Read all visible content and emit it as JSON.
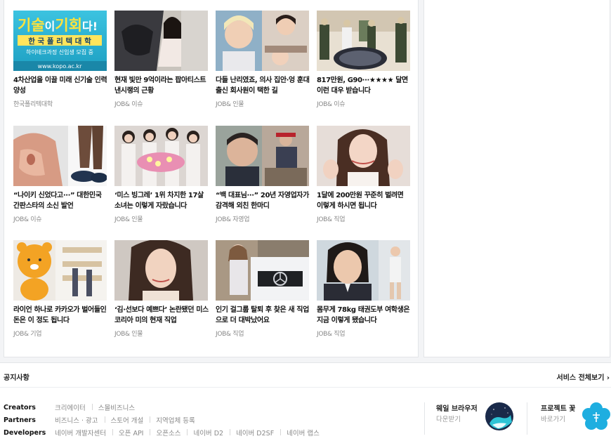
{
  "cards": [
    {
      "title": "4차산업을 이끌 미래 신기술 인력 양성",
      "source": "한국폴리텍대학",
      "thumb": "ad-kopo",
      "ad": {
        "headline_a": "기술",
        "headline_b": "이",
        "headline_c": "기회",
        "headline_d": "다!",
        "org": "한 국 폴 리 텍 대 학",
        "sub": "하이테크과정 신입생 모집 중",
        "url": "www.kopo.ac.kr"
      }
    },
    {
      "title": "현재 빛만 9억이라는 팝아티스트 낸시랭의 근황",
      "source": "JOB& 이슈",
      "thumb": "woman-sitting"
    },
    {
      "title": "다들 난리였죠, 의사 집안·엉 훈대 출신 회사원이 택한 길",
      "source": "JOB& 인물",
      "thumb": "portraits"
    },
    {
      "title": "817만원, G90···★★★★ 달면 이런 대우 받습니다",
      "source": "JOB& 이슈",
      "thumb": "officers"
    },
    {
      "title": "“나이키 신었다고···” 대한민국 간판스타의 소신 발언",
      "source": "JOB& 이슈",
      "thumb": "feet"
    },
    {
      "title": "‘미스 빙그레’ 1위 차지한 17살 소녀는 이렇게 자랐습니다",
      "source": "JOB& 인물",
      "thumb": "girls"
    },
    {
      "title": "“백 대표님···” 20년 자영업자가 감격해 외친 한마디",
      "source": "JOB& 자영업",
      "thumb": "chef"
    },
    {
      "title": "1달에 200만원 꾸준히 벌려면 이렇게 하시면 됩니다",
      "source": "JOB& 직업",
      "thumb": "waving"
    },
    {
      "title": "라이언 하나로 카카오가 벌어들인 돈은 이 정도 됩니다",
      "source": "JOB& 기업",
      "thumb": "ryan"
    },
    {
      "title": "‘김·선보다 예쁘다’ 논란됐던 미스코리아 미의 현재 직업",
      "source": "JOB& 인물",
      "thumb": "misskorea"
    },
    {
      "title": "인기 걸그룹 탈퇴 후 찾은 새 직업으로 더 대박났어요",
      "source": "JOB& 직업",
      "thumb": "mercedes"
    },
    {
      "title": "몸무게 78kg 태권도부 여학생은 지금 이렇게 됐습니다",
      "source": "JOB& 직업",
      "thumb": "student"
    }
  ],
  "footer": {
    "notice_label": "공지사항",
    "service_all": "서비스 전체보기 ›",
    "rows": [
      {
        "heading": "Creators",
        "links": [
          "크리에이터",
          "스몰비즈니스"
        ]
      },
      {
        "heading": "Partners",
        "links": [
          "비즈니스 · 광고",
          "스토어 개설",
          "지역업체 등록"
        ]
      },
      {
        "heading": "Developers",
        "links": [
          "네이버 개발자센터",
          "오픈 API",
          "오픈소스",
          "네이버 D2",
          "네이버 D2SF",
          "네이버 랩스"
        ]
      }
    ],
    "apps": [
      {
        "title": "웨일 브라우저",
        "sub": "다운받기",
        "icon": "whale-icon"
      },
      {
        "title": "프로젝트 꽃",
        "sub": "바로가기",
        "icon": "flower-icon"
      }
    ]
  }
}
